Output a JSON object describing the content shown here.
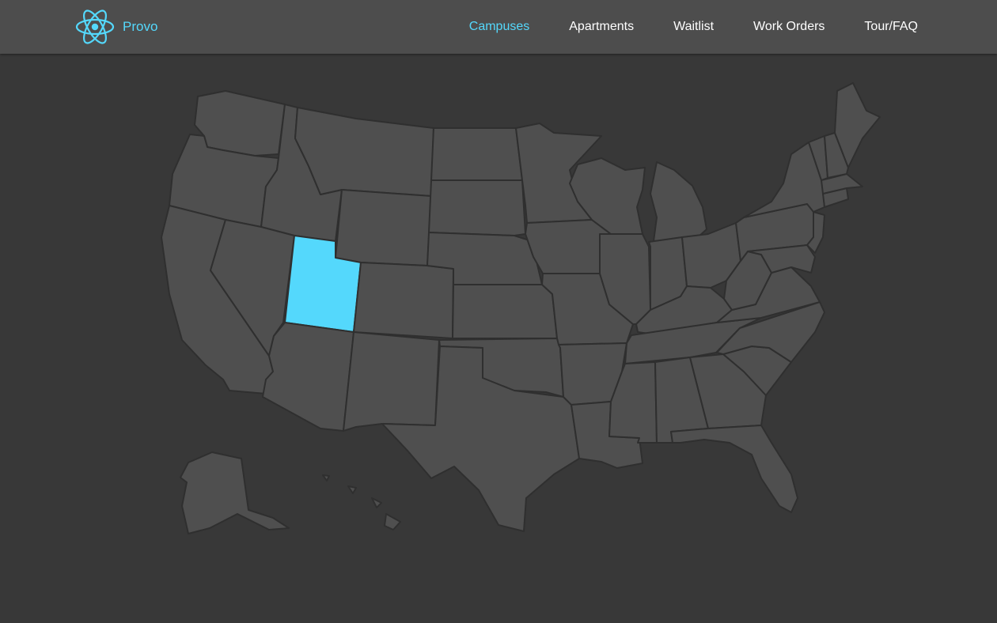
{
  "brand": {
    "name": "Provo",
    "icon": "react-atom-icon"
  },
  "nav": {
    "items": [
      {
        "label": "Campuses",
        "active": true
      },
      {
        "label": "Apartments",
        "active": false
      },
      {
        "label": "Waitlist",
        "active": false
      },
      {
        "label": "Work Orders",
        "active": false
      },
      {
        "label": "Tour/FAQ",
        "active": false
      }
    ]
  },
  "map": {
    "selected_state": "Utah",
    "colors": {
      "background": "#383838",
      "state_fill": "#4f4f4f",
      "state_border": "#2f2f2f",
      "highlight": "#54d8fc"
    }
  }
}
